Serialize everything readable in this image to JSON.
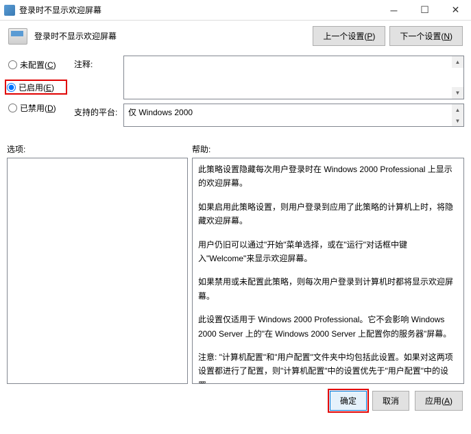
{
  "titlebar": {
    "title": "登录时不显示欢迎屏幕"
  },
  "header": {
    "title": "登录时不显示欢迎屏幕",
    "prev_button": "上一个设置(P)",
    "next_button": "下一个设置(N)"
  },
  "config": {
    "radios": {
      "not_configured": "未配置(C)",
      "enabled": "已启用(E)",
      "disabled": "已禁用(D)",
      "selected": "enabled"
    },
    "comment_label": "注释:",
    "comment_value": "",
    "platform_label": "支持的平台:",
    "platform_value": "仅 Windows 2000"
  },
  "sections": {
    "options_label": "选项:",
    "help_label": "帮助:"
  },
  "help_text": {
    "p1": "此策略设置隐藏每次用户登录时在 Windows 2000 Professional 上显示的欢迎屏幕。",
    "p2": "如果启用此策略设置，则用户登录到应用了此策略的计算机上时，将隐藏欢迎屏幕。",
    "p3": "用户仍旧可以通过\"开始\"菜单选择，或在\"运行\"对话框中键入\"Welcome\"来显示欢迎屏幕。",
    "p4": "如果禁用或未配置此策略，则每次用户登录到计算机时都将显示欢迎屏幕。",
    "p5": "此设置仅适用于 Windows 2000 Professional。它不会影响 Windows 2000 Server 上的\"在 Windows 2000 Server 上配置你的服务器\"屏幕。",
    "p6": "注意: \"计算机配置\"和\"用户配置\"文件夹中均包括此设置。如果对这两项设置都进行了配置，则\"计算机配置\"中的设置优先于\"用户配置\"中的设置。"
  },
  "footer": {
    "ok": "确定",
    "cancel": "取消",
    "apply": "应用(A)"
  }
}
